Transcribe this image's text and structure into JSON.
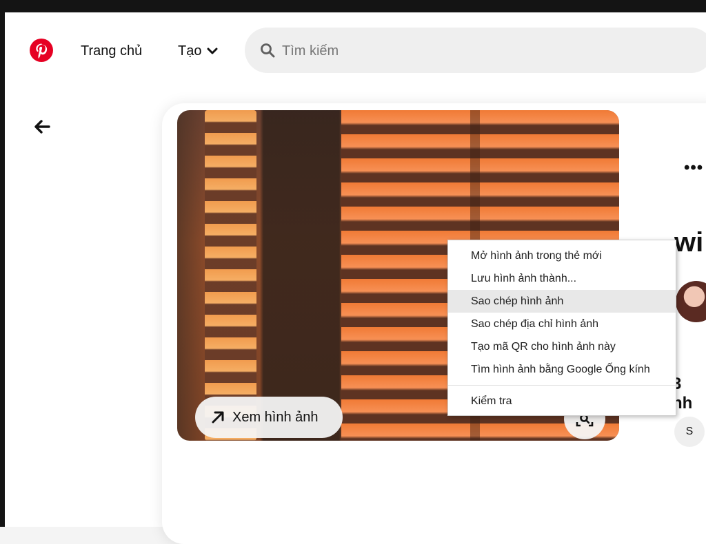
{
  "header": {
    "home_label": "Trang chủ",
    "create_label": "Tạo",
    "search_placeholder": "Tìm kiếm"
  },
  "pin": {
    "view_image_label": "Xem hình ảnh",
    "title_partial": "wi",
    "count_partial": "3 nh",
    "chip_label": "S"
  },
  "context_menu": {
    "items": [
      "Mở hình ảnh trong thẻ mới",
      "Lưu hình ảnh thành...",
      "Sao chép hình ảnh",
      "Sao chép địa chỉ hình ảnh",
      "Tạo mã QR cho hình ảnh này",
      "Tìm hình ảnh bằng Google Ống kính"
    ],
    "inspect_label": "Kiểm tra",
    "highlighted_index": 2
  },
  "colors": {
    "brand": "#e60023",
    "window_frame": "#141414"
  },
  "icons": [
    "pinterest-logo",
    "chevron-down-icon",
    "search-icon",
    "back-arrow-icon",
    "diagonal-arrow-icon",
    "lens-icon",
    "more-icon"
  ]
}
